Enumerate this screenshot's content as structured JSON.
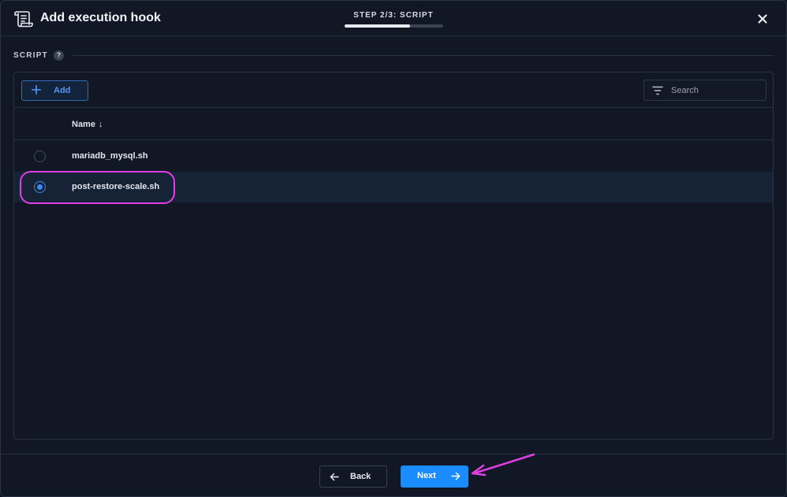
{
  "dialog": {
    "title": "Add execution hook",
    "step_label": "STEP 2/3: SCRIPT",
    "step_progress": 0.667
  },
  "section": {
    "label": "SCRIPT",
    "help_glyph": "?"
  },
  "toolbar": {
    "add_label": "Add",
    "search_placeholder": "Search"
  },
  "table": {
    "column_name": "Name",
    "sort_indicator": "↓",
    "rows": [
      {
        "name": "mariadb_mysql.sh",
        "selected": false
      },
      {
        "name": "post-restore-scale.sh",
        "selected": true
      }
    ]
  },
  "footer": {
    "back_label": "Back",
    "next_label": "Next"
  },
  "colors": {
    "accent": "#1a8cff",
    "annotation": "#e23ee6",
    "background": "#111725"
  },
  "icons": {
    "header": "scroll-icon",
    "close": "close-icon",
    "add": "plus-icon",
    "search": "filter-icon",
    "back": "arrow-left-icon",
    "next": "arrow-right-icon"
  }
}
